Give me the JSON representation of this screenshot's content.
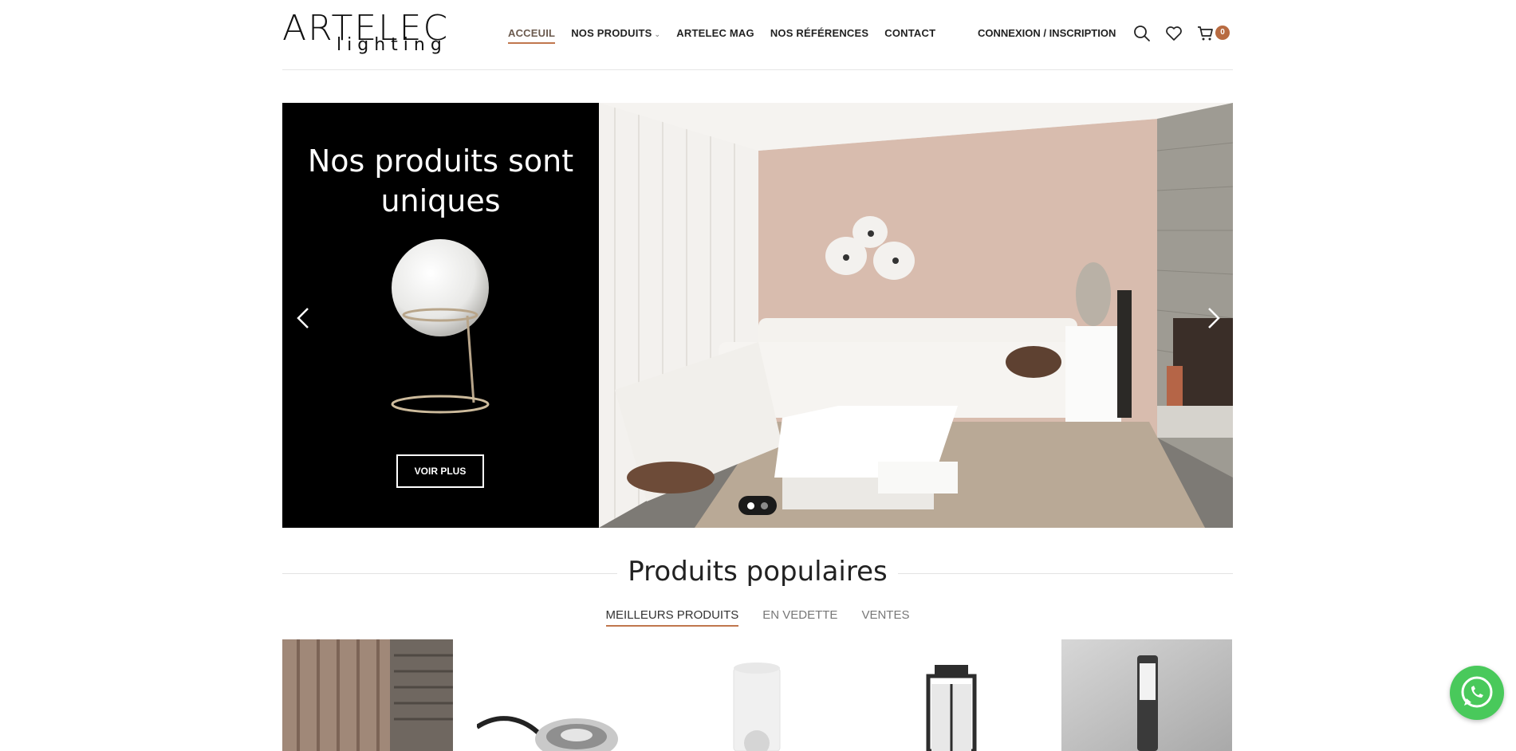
{
  "header": {
    "logo_main": "ARTELEC",
    "logo_sub": "lighting",
    "nav": [
      {
        "label": "ACCEUIL"
      },
      {
        "label": "NOS PRODUITS"
      },
      {
        "label": "ARTELEC MAG"
      },
      {
        "label": "NOS RÉFÉRENCES"
      },
      {
        "label": "CONTACT"
      }
    ],
    "account_label": "CONNEXION / INSCRIPTION",
    "cart_count": "0",
    "icons": [
      "search-icon",
      "heart-icon",
      "cart-icon"
    ]
  },
  "slider": {
    "title": "Nos produits sont uniques",
    "button_label": "VOIR PLUS",
    "dots": 2,
    "active_dot": 1
  },
  "section": {
    "title": "Produits populaires",
    "tabs": [
      {
        "label": "MEILLEURS PRODUITS"
      },
      {
        "label": "EN VEDETTE"
      },
      {
        "label": "VENTES"
      }
    ]
  },
  "colors": {
    "accent": "#c0764d",
    "cart_badge": "#b86b41",
    "whatsapp": "#49c95b"
  }
}
